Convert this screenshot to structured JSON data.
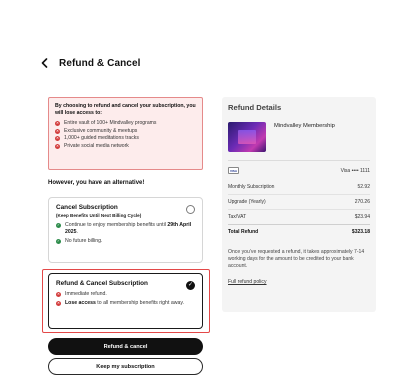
{
  "header": {
    "title": "Refund & Cancel"
  },
  "warning": {
    "title": "By choosing to refund and cancel your subscription, you will lose access to:",
    "items": [
      "Entire vault of 100+ Mindvalley programs",
      "Exclusive community & meetups",
      "1,000+ guided meditations tracks",
      "Private social media network"
    ]
  },
  "alternative_heading": "However, you have an alternative!",
  "options": [
    {
      "title": "Cancel Subscription",
      "subtitle": "(Keep Benefits Until Next Billing Cycle)",
      "bullets": [
        {
          "pre": "Continue to enjoy membership benefits until ",
          "bold": "29th April 2025",
          "post": "."
        },
        {
          "pre": "No future billing.",
          "bold": "",
          "post": ""
        }
      ],
      "selected": false
    },
    {
      "title": "Refund & Cancel Subscription",
      "bullets": [
        {
          "pre": "Immediate refund.",
          "bold": "",
          "post": ""
        },
        {
          "pre": "",
          "bold": "Lose access",
          "post": " to all membership benefits right away."
        }
      ],
      "selected": true
    }
  ],
  "buttons": {
    "primary": "Refund & cancel",
    "secondary": "Keep my subscription"
  },
  "details": {
    "title": "Refund Details",
    "product_name": "Mindvalley Membership",
    "card_brand": "VISA",
    "card_text": "Visa •••• 1111",
    "lines": [
      {
        "label": "Monthly Subscription",
        "value": "52.92"
      },
      {
        "label": "Upgrade (Yearly)",
        "value": "270.26"
      },
      {
        "label": "Tax/VAT",
        "value": "$23.94"
      }
    ],
    "total": {
      "label": "Total Refund",
      "value": "$323.18"
    },
    "note": "Once you’ve requested a refund, it takes approximately 7-14 working days for the amount to be credited to your bank account.",
    "policy_link": "Full refund policy"
  },
  "colors": {
    "danger": "#d23b3b",
    "success": "#2c8b4a",
    "warning_bg": "#fdecec",
    "primary": "#111111"
  },
  "icons": {
    "back": "chevron-left-icon",
    "loss": "x-circle-icon",
    "benefit": "check-circle-icon",
    "selected": "check-icon"
  }
}
